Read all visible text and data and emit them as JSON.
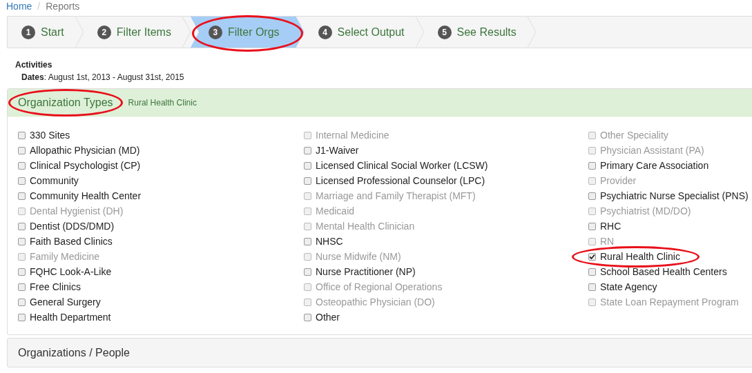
{
  "breadcrumb": [
    {
      "label": "Home",
      "kind": "link"
    },
    {
      "label": "/",
      "kind": "separator"
    },
    {
      "label": "Reports",
      "kind": "current"
    }
  ],
  "steps": [
    {
      "number": "1",
      "label": "Start",
      "selected": false,
      "circled": false
    },
    {
      "number": "2",
      "label": "Filter Items",
      "selected": false,
      "circled": false
    },
    {
      "number": "3",
      "label": "Filter Orgs",
      "selected": true,
      "circled": true
    },
    {
      "number": "4",
      "label": "Select Output",
      "selected": false,
      "circled": false
    },
    {
      "number": "5",
      "label": "See Results",
      "selected": false,
      "circled": false
    }
  ],
  "summary": {
    "title": "Activities",
    "dates": "**Dates**: August 1st, 2013 - August 31st, 2015"
  },
  "org_types": {
    "title": "Organization Types",
    "circled": true,
    "selection": "Rural Health Clinic",
    "expanded": true,
    "columns": [
      [
        {
          "label": "330 Sites",
          "checked": false,
          "disabled": false,
          "circled": false
        },
        {
          "label": "Allopathic Physician (MD)",
          "checked": false,
          "disabled": false,
          "circled": false
        },
        {
          "label": "Clinical Psychologist (CP)",
          "checked": false,
          "disabled": false,
          "circled": false
        },
        {
          "label": "Community",
          "checked": false,
          "disabled": false,
          "circled": false
        },
        {
          "label": "Community Health Center",
          "checked": false,
          "disabled": false,
          "circled": false
        },
        {
          "label": "Dental Hygienist (DH)",
          "checked": false,
          "disabled": true,
          "circled": false
        },
        {
          "label": "Dentist (DDS/DMD)",
          "checked": false,
          "disabled": false,
          "circled": false
        },
        {
          "label": "Faith Based Clinics",
          "checked": false,
          "disabled": false,
          "circled": false
        },
        {
          "label": "Family Medicine",
          "checked": false,
          "disabled": true,
          "circled": false
        },
        {
          "label": "FQHC Look-A-Like",
          "checked": false,
          "disabled": false,
          "circled": false
        },
        {
          "label": "Free Clinics",
          "checked": false,
          "disabled": false,
          "circled": false
        },
        {
          "label": "General Surgery",
          "checked": false,
          "disabled": false,
          "circled": false
        },
        {
          "label": "Health Department",
          "checked": false,
          "disabled": false,
          "circled": false
        }
      ],
      [
        {
          "label": "Internal Medicine",
          "checked": false,
          "disabled": true,
          "circled": false
        },
        {
          "label": "J1-Waiver",
          "checked": false,
          "disabled": false,
          "circled": false
        },
        {
          "label": "Licensed Clinical Social Worker (LCSW)",
          "checked": false,
          "disabled": false,
          "circled": false
        },
        {
          "label": "Licensed Professional Counselor (LPC)",
          "checked": false,
          "disabled": false,
          "circled": false
        },
        {
          "label": "Marriage and Family Therapist (MFT)",
          "checked": false,
          "disabled": true,
          "circled": false
        },
        {
          "label": "Medicaid",
          "checked": false,
          "disabled": true,
          "circled": false
        },
        {
          "label": "Mental Health Clinician",
          "checked": false,
          "disabled": true,
          "circled": false
        },
        {
          "label": "NHSC",
          "checked": false,
          "disabled": false,
          "circled": false
        },
        {
          "label": "Nurse Midwife (NM)",
          "checked": false,
          "disabled": true,
          "circled": false
        },
        {
          "label": "Nurse Practitioner (NP)",
          "checked": false,
          "disabled": false,
          "circled": false
        },
        {
          "label": "Office of Regional Operations",
          "checked": false,
          "disabled": true,
          "circled": false
        },
        {
          "label": "Osteopathic Physician (DO)",
          "checked": false,
          "disabled": true,
          "circled": false
        },
        {
          "label": "Other",
          "checked": false,
          "disabled": false,
          "circled": false
        }
      ],
      [
        {
          "label": "Other Speciality",
          "checked": false,
          "disabled": true,
          "circled": false
        },
        {
          "label": "Physician Assistant (PA)",
          "checked": false,
          "disabled": true,
          "circled": false
        },
        {
          "label": "Primary Care Association",
          "checked": false,
          "disabled": false,
          "circled": false
        },
        {
          "label": "Provider",
          "checked": false,
          "disabled": true,
          "circled": false
        },
        {
          "label": "Psychiatric Nurse Specialist (PNS)",
          "checked": false,
          "disabled": false,
          "circled": false
        },
        {
          "label": "Psychiatrist (MD/DO)",
          "checked": false,
          "disabled": true,
          "circled": false
        },
        {
          "label": "RHC",
          "checked": false,
          "disabled": false,
          "circled": false
        },
        {
          "label": "RN",
          "checked": false,
          "disabled": true,
          "circled": false
        },
        {
          "label": "Rural Health Clinic",
          "checked": true,
          "disabled": false,
          "circled": true
        },
        {
          "label": "School Based Health Centers",
          "checked": false,
          "disabled": false,
          "circled": false
        },
        {
          "label": "State Agency",
          "checked": false,
          "disabled": false,
          "circled": false
        },
        {
          "label": "State Loan Repayment Program",
          "checked": false,
          "disabled": true,
          "circled": false
        }
      ]
    ]
  },
  "orgs_panel": {
    "title": "Organizations / People"
  }
}
